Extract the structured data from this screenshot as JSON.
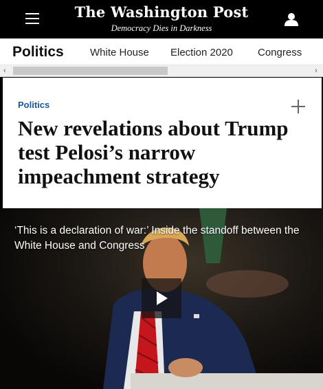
{
  "header": {
    "logo": "The Washington Post",
    "tagline": "Democracy Dies in Darkness",
    "menu_icon": "hamburger-menu-icon",
    "user_icon": "user-account-icon"
  },
  "nav": {
    "section": "Politics",
    "items": [
      "White House",
      "Election 2020",
      "Congress"
    ]
  },
  "article": {
    "kicker": "Politics",
    "headline": "New revelations about Trump test Pelosi’s narrow impeachment strategy",
    "add_icon": "plus-icon"
  },
  "media": {
    "caption": "‘This is a declaration of war:’ Inside the standoff between the White House and Congress",
    "play_icon": "play-icon"
  }
}
